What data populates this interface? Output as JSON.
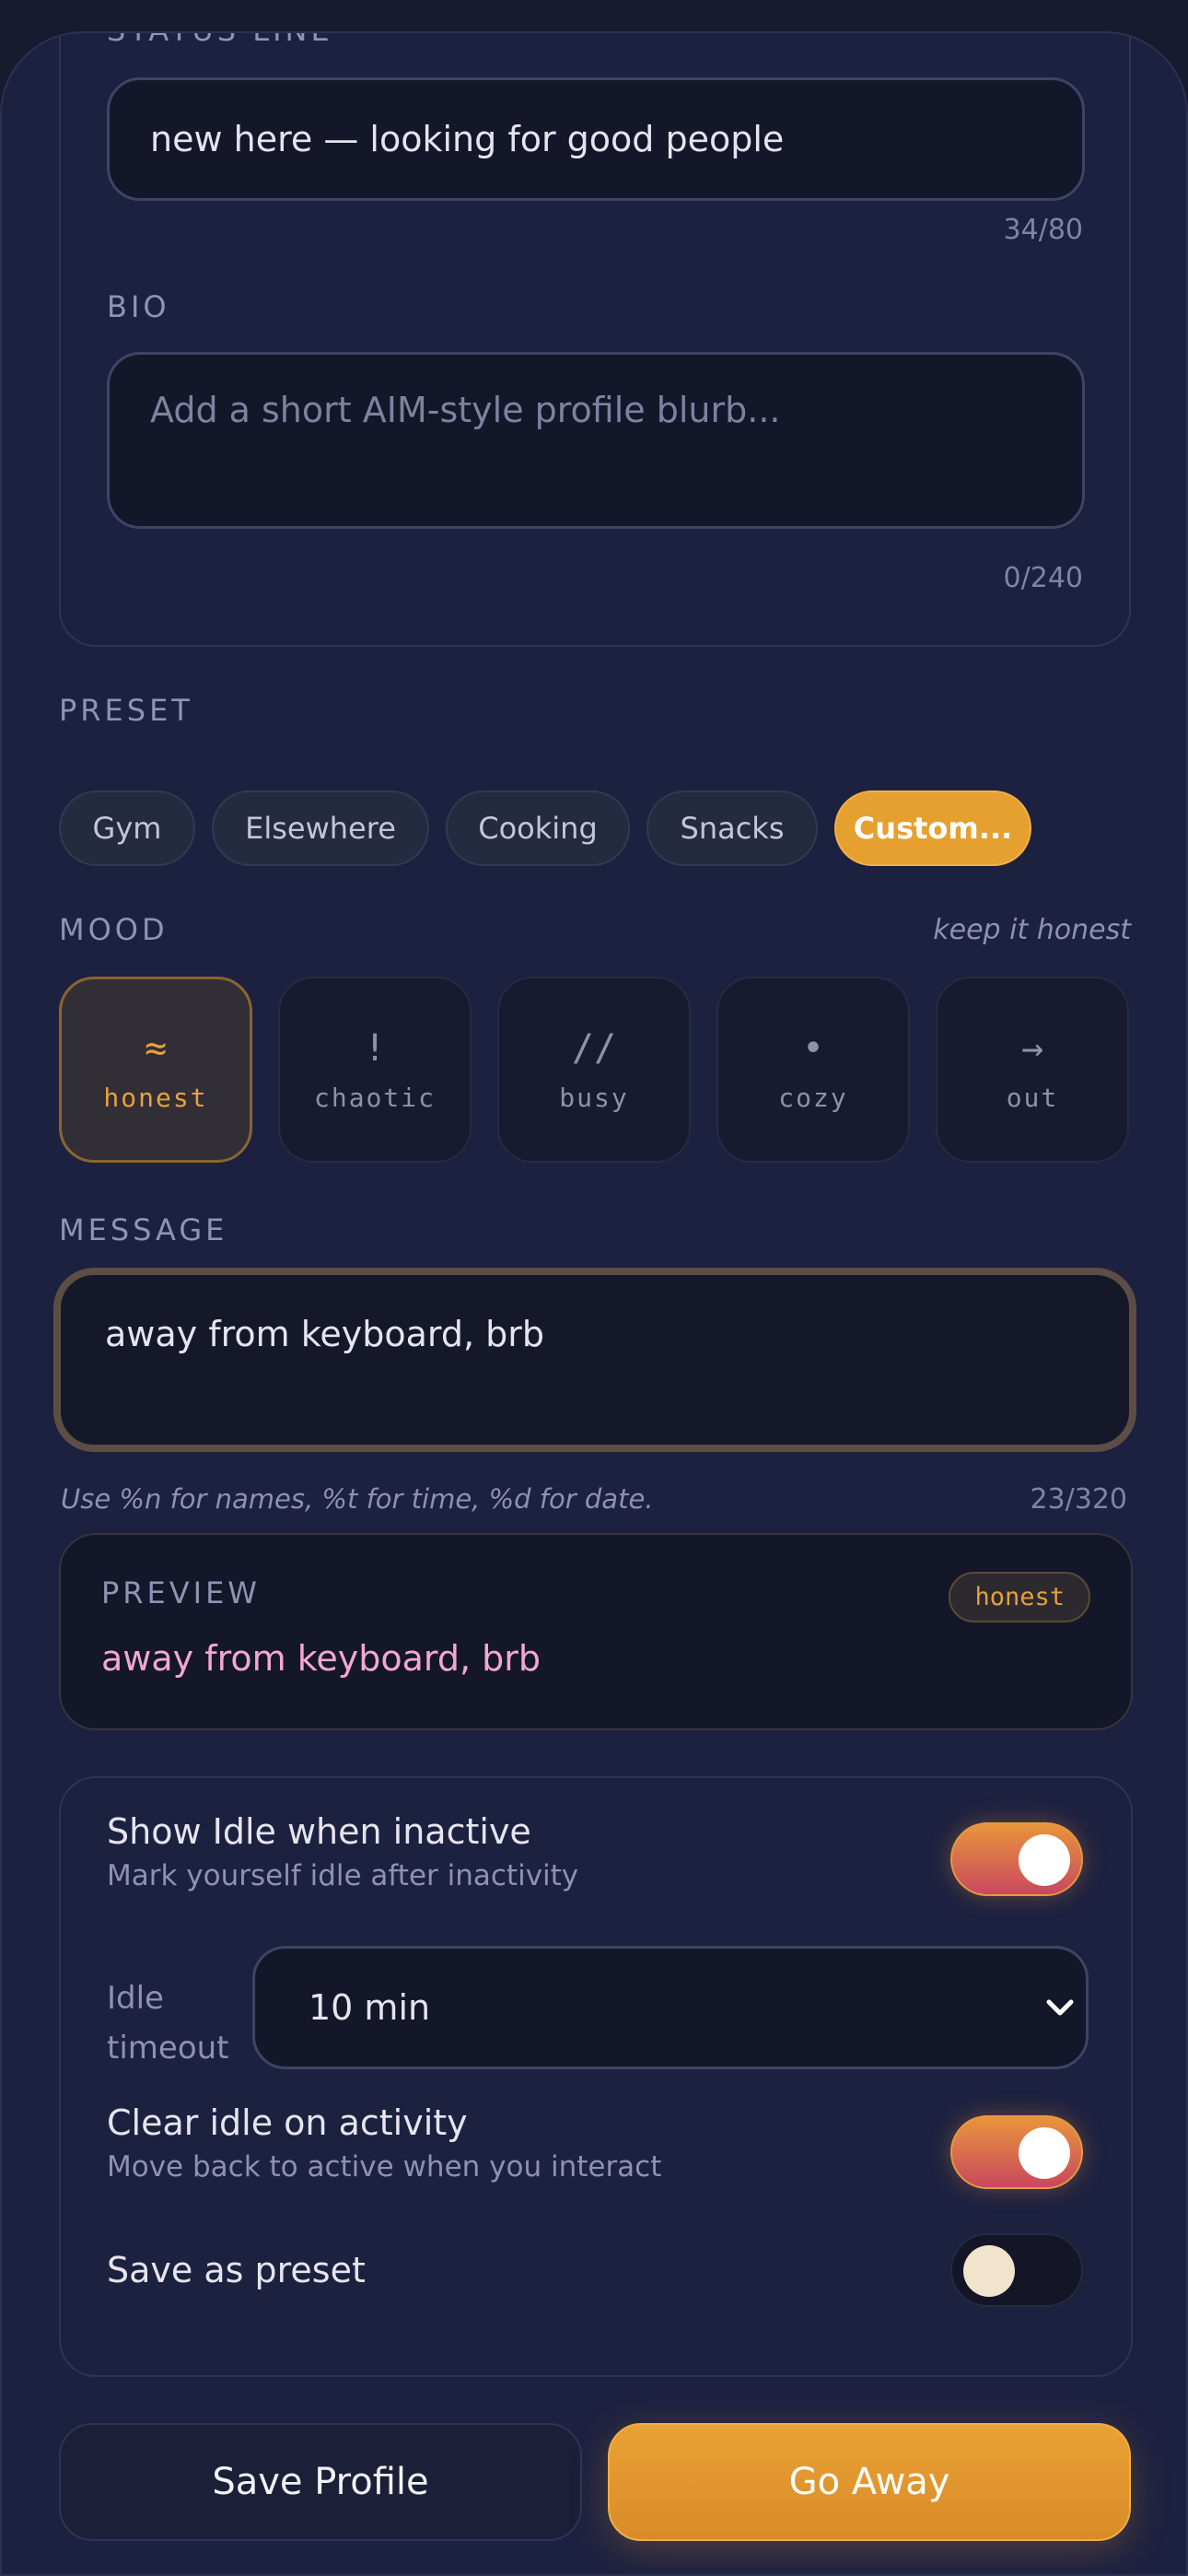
{
  "status_line": {
    "label": "STATUS LINE",
    "value": "new here — looking for good people",
    "counter": "34/80"
  },
  "bio": {
    "label": "BIO",
    "placeholder": "Add a short AIM-style profile blurb...",
    "counter": "0/240"
  },
  "preset": {
    "label": "PRESET",
    "chips": [
      "Gym",
      "Elsewhere",
      "Cooking",
      "Snacks",
      "Custom..."
    ],
    "selected": "Custom..."
  },
  "mood": {
    "label": "MOOD",
    "hint": "keep it honest",
    "options": [
      {
        "glyph": "≈",
        "label": "honest"
      },
      {
        "glyph": "!",
        "label": "chaotic"
      },
      {
        "glyph": "//",
        "label": "busy"
      },
      {
        "glyph": "•",
        "label": "cozy"
      },
      {
        "glyph": "→",
        "label": "out"
      }
    ],
    "selected": "honest"
  },
  "message": {
    "label": "MESSAGE",
    "value": "away from keyboard, brb",
    "help": "Use %n for names, %t for time, %d for date.",
    "counter": "23/320"
  },
  "preview": {
    "label": "PREVIEW",
    "badge": "honest",
    "text": "away from keyboard, brb"
  },
  "settings": {
    "show_idle": {
      "title": "Show Idle when inactive",
      "subtitle": "Mark yourself idle after inactivity",
      "on": true
    },
    "idle_timeout": {
      "label_line1": "Idle",
      "label_line2": "timeout",
      "value": "10 min"
    },
    "clear_idle": {
      "title": "Clear idle on activity",
      "subtitle": "Move back to active when you interact",
      "on": true
    },
    "save_preset": {
      "title": "Save as preset",
      "on": false
    }
  },
  "actions": {
    "save_profile": "Save Profile",
    "go_away": "Go Away"
  },
  "colors": {
    "accent": "#e6a030",
    "background": "#1d2140",
    "preview_text": "#f2a7d3"
  }
}
